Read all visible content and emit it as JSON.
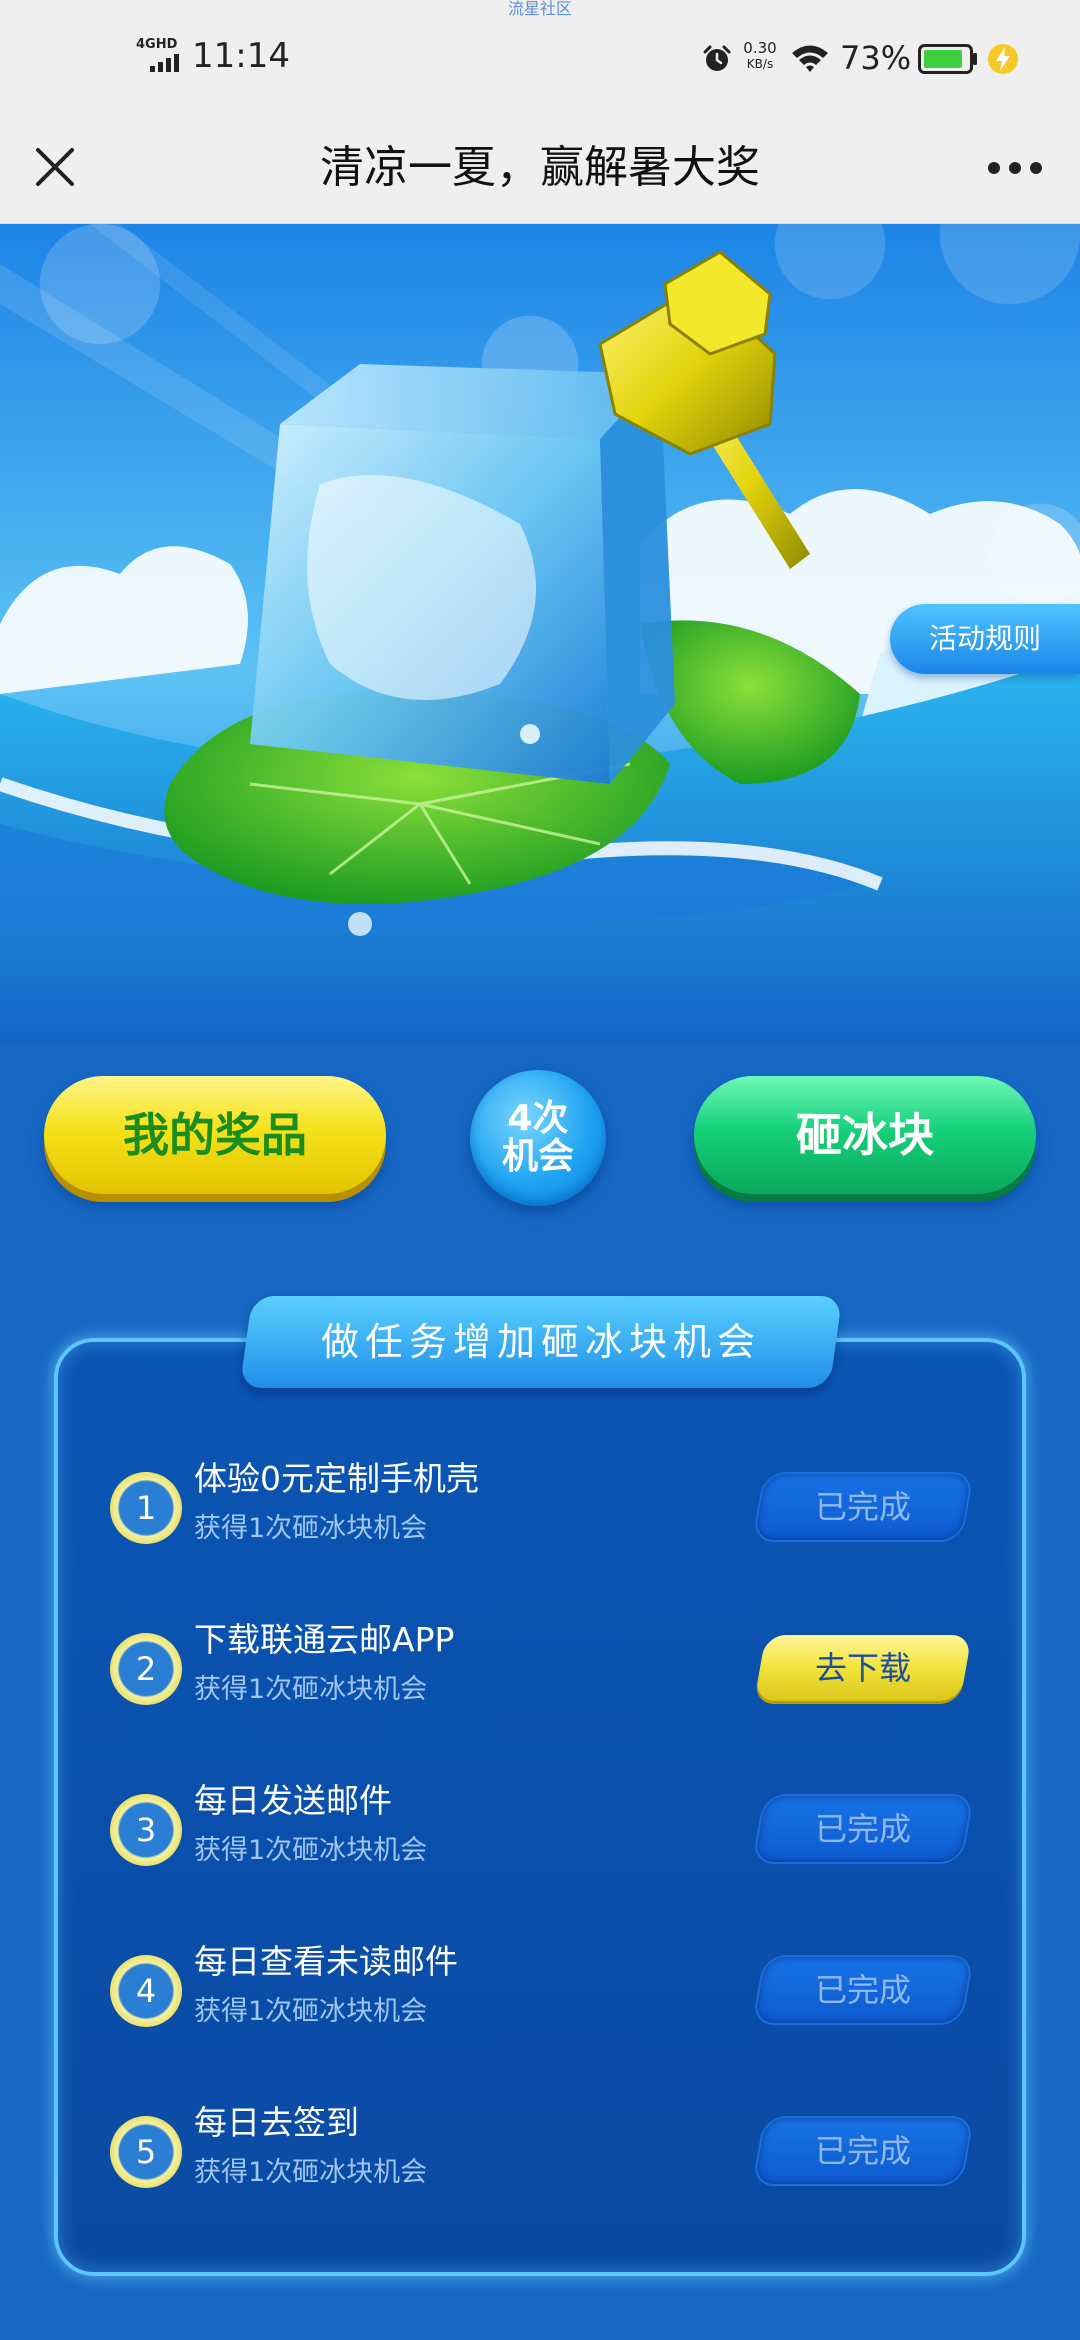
{
  "watermark": "流星社区",
  "status_bar": {
    "network": "4GHD",
    "time": "11:14",
    "speed_value": "0.30",
    "speed_unit": "KB/s",
    "battery": "73%"
  },
  "nav": {
    "title": "清凉一夏，赢解暑大奖"
  },
  "hero": {
    "rules_label": "活动规则"
  },
  "actions": {
    "prizes_label": "我的奖品",
    "chances_line1": "4次",
    "chances_line2": "机会",
    "smash_label": "砸冰块"
  },
  "tasks_panel": {
    "title": "做任务增加砸冰块机会",
    "items": [
      {
        "num": "1",
        "title": "体验0元定制手机壳",
        "sub": "获得1次砸冰块机会",
        "action": "已完成",
        "state": "done"
      },
      {
        "num": "2",
        "title": "下载联通云邮APP",
        "sub": "获得1次砸冰块机会",
        "action": "去下载",
        "state": "todo"
      },
      {
        "num": "3",
        "title": "每日发送邮件",
        "sub": "获得1次砸冰块机会",
        "action": "已完成",
        "state": "done"
      },
      {
        "num": "4",
        "title": "每日查看未读邮件",
        "sub": "获得1次砸冰块机会",
        "action": "已完成",
        "state": "done"
      },
      {
        "num": "5",
        "title": "每日去签到",
        "sub": "获得1次砸冰块机会",
        "action": "已完成",
        "state": "done"
      }
    ]
  },
  "colors": {
    "page_bg": "#1668c4",
    "prizes_yellow": "#f5e21a",
    "smash_green": "#16d17a",
    "panel_blue": "#0b55b4"
  }
}
